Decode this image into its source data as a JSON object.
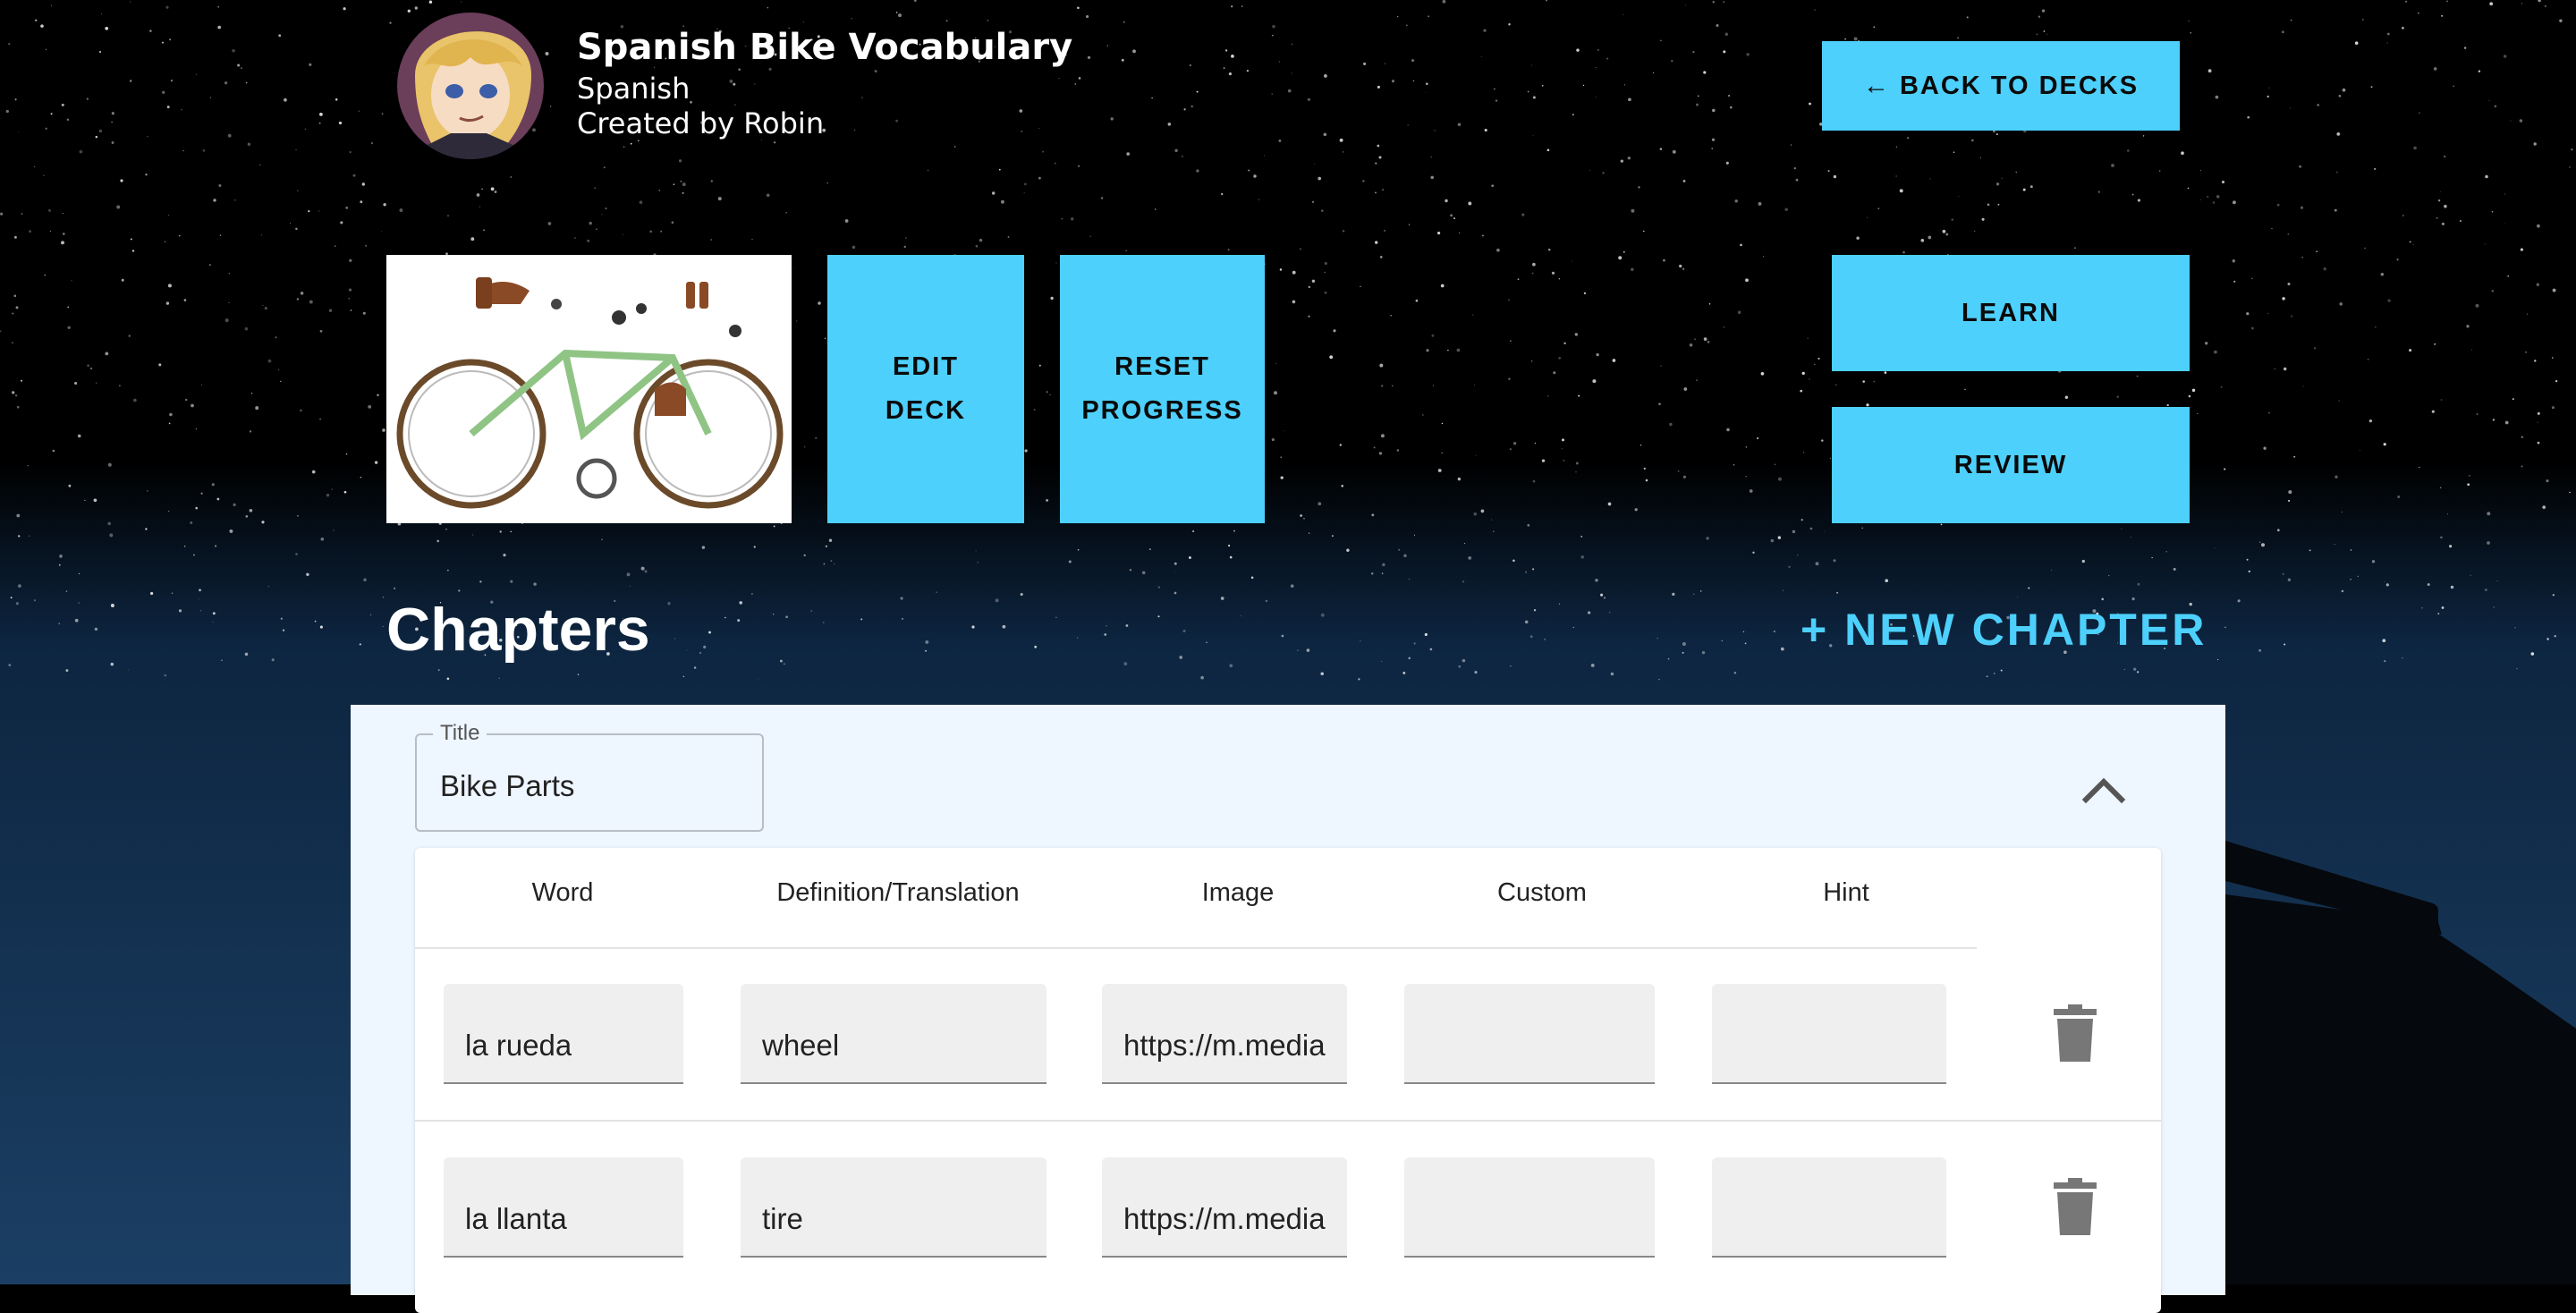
{
  "deck": {
    "title": "Spanish Bike Vocabulary",
    "language": "Spanish",
    "author": "Created by Robin"
  },
  "buttons": {
    "back": "← BACK TO DECKS",
    "edit": "EDIT DECK",
    "reset": "RESET PROGRESS",
    "learn": "LEARN",
    "review": "REVIEW",
    "new_chapter": "+ NEW CHAPTER"
  },
  "chapters": {
    "heading": "Chapters",
    "chapter": {
      "title_label": "Title",
      "title_value": "Bike Parts",
      "columns": [
        "Word",
        "Definition/Translation",
        "Image",
        "Custom",
        "Hint"
      ],
      "rows": [
        {
          "word": "la rueda",
          "definition": "wheel",
          "image": "https://m.media",
          "custom": "",
          "hint": ""
        },
        {
          "word": "la llanta",
          "definition": "tire",
          "image": "https://m.media",
          "custom": "",
          "hint": ""
        }
      ]
    }
  },
  "colors": {
    "accent": "#4dd0fb",
    "panel": "#eef6ff",
    "cell": "#efefef"
  },
  "icons": [
    "avatar",
    "bike-parts-image",
    "chevron-up-icon",
    "trash-icon",
    "telescope-silhouette"
  ]
}
